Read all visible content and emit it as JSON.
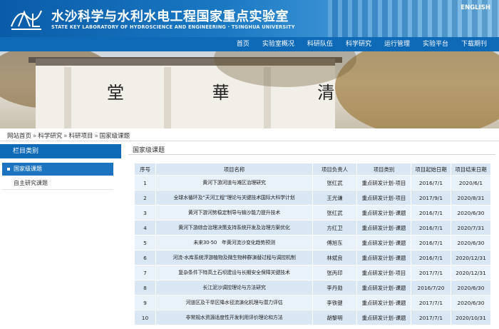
{
  "header": {
    "title": "水沙科学与水利水电工程国家重点实验室",
    "subtitle": "STATE KEY LABORATORY OF HYDROSCIENCE AND ENGINEERING · TSINGHUA UNIVERSITY",
    "lang_link": "ENGLISH",
    "logo_text": "SKL"
  },
  "nav": {
    "items": [
      {
        "label": "首页"
      },
      {
        "label": "实验室概况"
      },
      {
        "label": "科研队伍"
      },
      {
        "label": "科学研究"
      },
      {
        "label": "运行管理"
      },
      {
        "label": "实验平台"
      },
      {
        "label": "下载期刊"
      }
    ]
  },
  "banner": {
    "chars": "堂 華 清"
  },
  "breadcrumb": {
    "items": [
      "网站首页",
      "科学研究",
      "科研项目",
      "国家级课题"
    ],
    "separator": "»"
  },
  "sidebar": {
    "title": "栏目类别",
    "items": [
      {
        "label": "国家级课题",
        "active": true
      },
      {
        "label": "自主研究课题",
        "active": false
      }
    ]
  },
  "main": {
    "title": "国家级课题",
    "columns": [
      "序号",
      "项目名称",
      "项目负责人",
      "项目类别",
      "项目起始日期",
      "项目结束日期"
    ],
    "rows": [
      {
        "no": "1",
        "name": "黄河下游河道与滩区治理研究",
        "leader": "张红武",
        "category": "重点研发计划-项目",
        "start": "2016/7/1",
        "end": "2020/6/1"
      },
      {
        "no": "2",
        "name": "全球水循环及“天河工程”理论与关键技术国际大科学计划",
        "leader": "王光谦",
        "category": "重点研发计划-项目",
        "start": "2017/9/1",
        "end": "2020/8/31"
      },
      {
        "no": "3",
        "name": "黄河下游河势稳定制导与输沙能力提升技术",
        "leader": "张红武",
        "category": "重点研发计划-课题",
        "start": "2016/7/1",
        "end": "2020/6/30"
      },
      {
        "no": "4",
        "name": "黄河下游综合治理决策支持系统开发及治理方案优化",
        "leader": "方红卫",
        "category": "重点研发计划-课题",
        "start": "2016/7/1",
        "end": "2020/7/31"
      },
      {
        "no": "5",
        "name": "未来30-50　年黄河流沙变化趋势预测",
        "leader": "傅旭东",
        "category": "重点研发计划-课题",
        "start": "2016/7/1",
        "end": "2020/6/30"
      },
      {
        "no": "6",
        "name": "河流-水库系统浮游植物及微生物种群演替过程与调控机制",
        "leader": "林斌良",
        "category": "重点研发计划-课题",
        "start": "2016/7/1",
        "end": "2020/12/31"
      },
      {
        "no": "7",
        "name": "复杂条件下特高土石坝建设与长期安全保障关键技术",
        "leader": "张丙印",
        "category": "重点研发计划-项目",
        "start": "2017/7/1",
        "end": "2020/12/31"
      },
      {
        "no": "8",
        "name": "长江泥沙调控理论与方法研究",
        "leader": "李丹勋",
        "category": "重点研发计划-课题",
        "start": "2016/7/20",
        "end": "2020/6/30"
      },
      {
        "no": "9",
        "name": "河道区及干旱区降水径流演化机理与潜力评估",
        "leader": "李铁键",
        "category": "重点研发计划-课题",
        "start": "2017/7/1",
        "end": "2020/6/30"
      },
      {
        "no": "10",
        "name": "非常规水资源适度性开发利用评价理论和方法",
        "leader": "胡黎明",
        "category": "重点研发计划-课题",
        "start": "2017/7/1",
        "end": "2020/10/31"
      }
    ]
  },
  "colors": {
    "primary": "#0e69b6",
    "active": "#1c74c1",
    "row_light": "#e9f1fa",
    "row_dark": "#d9e7f5"
  }
}
